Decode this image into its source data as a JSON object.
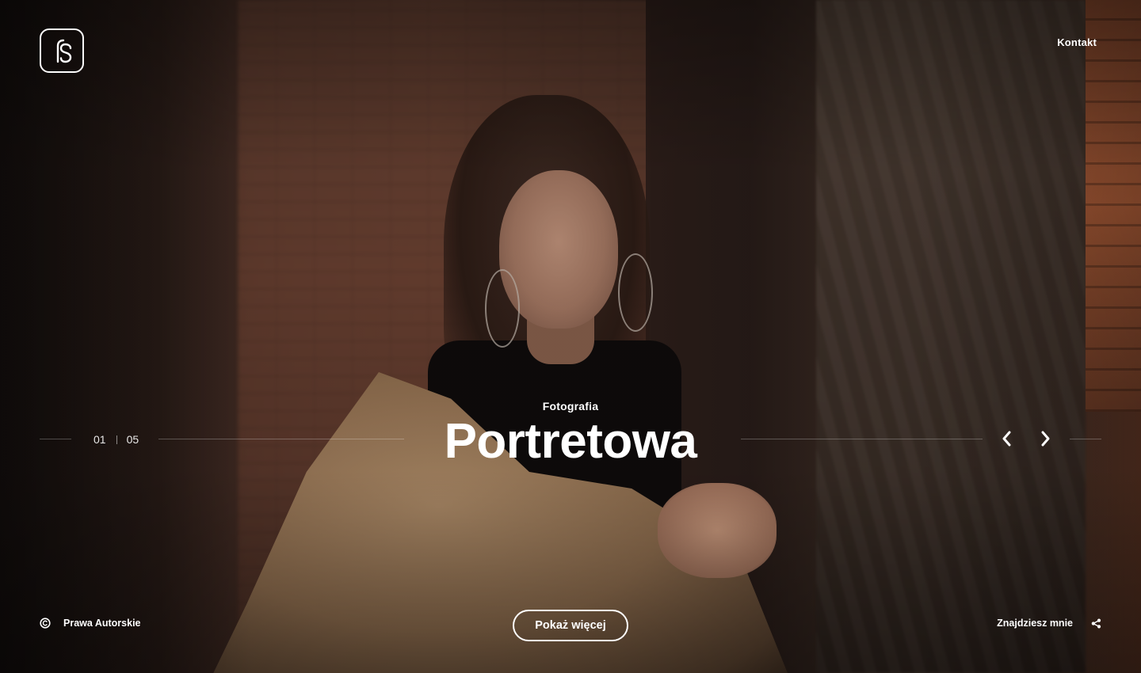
{
  "header": {
    "logo_text": "fS",
    "nav": {
      "contact_label": "Kontakt"
    }
  },
  "slider": {
    "current": "01",
    "total": "05",
    "subtitle": "Fotografia",
    "title": "Portretowa",
    "prev_icon": "chevron-left-icon",
    "next_icon": "chevron-right-icon"
  },
  "footer": {
    "copyright_icon": "copyright-icon",
    "copyright_label": "Prawa Autorskie",
    "show_more_label": "Pokaż więcej",
    "find_me_label": "Znajdziesz mnie",
    "share_icon": "share-icon"
  },
  "colors": {
    "text": "#ffffff",
    "line": "rgba(255,255,255,0.25)"
  }
}
